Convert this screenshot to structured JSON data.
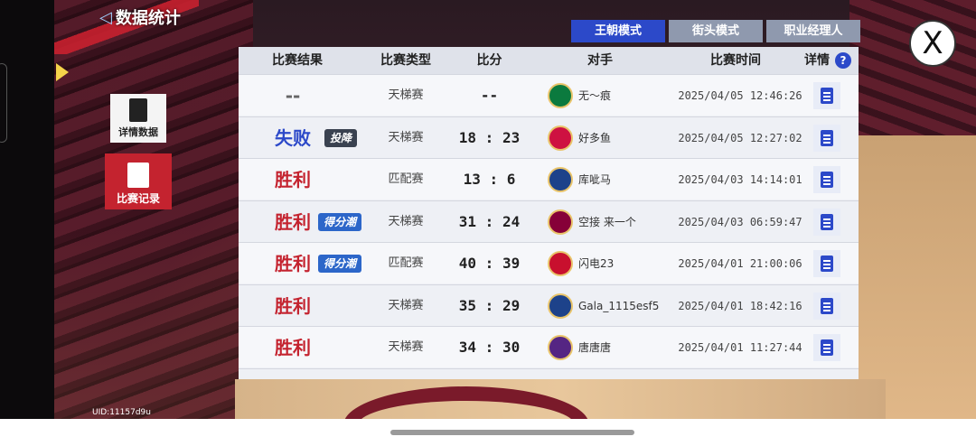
{
  "title": {
    "back_icon": "◁",
    "text": "数据统计"
  },
  "tabs": [
    {
      "label": "王朝模式"
    },
    {
      "label": "街头模式"
    },
    {
      "label": "职业经理人"
    }
  ],
  "close_label": "X",
  "side": {
    "detail_label": "详情数据",
    "record_label": "比赛记录"
  },
  "table": {
    "headers": {
      "result": "比赛结果",
      "type": "比赛类型",
      "score": "比分",
      "opponent": "对手",
      "time": "比赛时间",
      "detail": "详情",
      "help": "?"
    },
    "rows": [
      {
        "result": "--",
        "badge": "",
        "type": "天梯赛",
        "score": "--",
        "opponent": "无～痕",
        "time": "2025/04/05 12:46:26",
        "logo_color": "#0b7a3e"
      },
      {
        "result": "失败",
        "badge": "投降",
        "type": "天梯赛",
        "score": "18 : 23",
        "opponent": "好多鱼",
        "time": "2025/04/05 12:27:02",
        "logo_color": "#ce1141"
      },
      {
        "result": "胜利",
        "badge": "",
        "type": "匹配赛",
        "score": "13 : 6",
        "opponent": "库呲马",
        "time": "2025/04/03 14:14:01",
        "logo_color": "#1d428a"
      },
      {
        "result": "胜利",
        "badge": "得分潮",
        "type": "天梯赛",
        "score": "31 : 24",
        "opponent": "空接 来一个",
        "time": "2025/04/03 06:59:47",
        "logo_color": "#860038"
      },
      {
        "result": "胜利",
        "badge": "得分潮",
        "type": "匹配赛",
        "score": "40 : 39",
        "opponent": "闪电23",
        "time": "2025/04/01 21:00:06",
        "logo_color": "#c8102e"
      },
      {
        "result": "胜利",
        "badge": "",
        "type": "天梯赛",
        "score": "35 : 29",
        "opponent": "Gala_1115esf5",
        "time": "2025/04/01 18:42:16",
        "logo_color": "#1d428a"
      },
      {
        "result": "胜利",
        "badge": "",
        "type": "天梯赛",
        "score": "34 : 30",
        "opponent": "唐唐唐",
        "time": "2025/04/01 11:27:44",
        "logo_color": "#552583"
      }
    ]
  },
  "uid": "UID:11157d9u",
  "colors": {
    "accent_blue": "#2c49c9",
    "win_red": "#c4232f",
    "tab_inactive": "#8f99ae"
  }
}
